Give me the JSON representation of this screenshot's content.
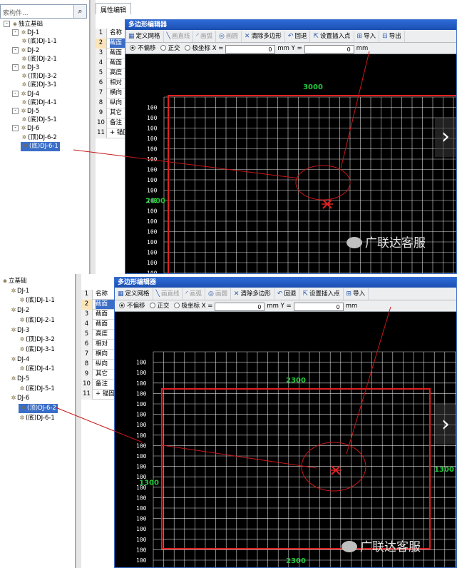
{
  "colors": {
    "accent": "#3a6ec8",
    "title_bar": "#1b4fb0",
    "polygon": "#e02020",
    "grid_line": "#ffffff",
    "dim_text": "#22c83c",
    "annotation": "#c81818"
  },
  "panel1": {
    "search_placeholder": "索构件...",
    "search_icon": "magnifier-icon",
    "tree": [
      {
        "label": "独立基础",
        "level": 0,
        "expander": "-"
      },
      {
        "label": "DJ-1",
        "level": 1,
        "expander": "-"
      },
      {
        "label": "(底)DJ-1-1",
        "level": 2
      },
      {
        "label": "DJ-2",
        "level": 1,
        "expander": "-"
      },
      {
        "label": "(底)DJ-2-1",
        "level": 2
      },
      {
        "label": "DJ-3",
        "level": 1,
        "expander": "-"
      },
      {
        "label": "(顶)DJ-3-2",
        "level": 2
      },
      {
        "label": "(底)DJ-3-1",
        "level": 2
      },
      {
        "label": "DJ-4",
        "level": 1,
        "expander": "-"
      },
      {
        "label": "(底)DJ-4-1",
        "level": 2
      },
      {
        "label": "DJ-5",
        "level": 1,
        "expander": "-"
      },
      {
        "label": "(底)DJ-5-1",
        "level": 2
      },
      {
        "label": "DJ-6",
        "level": 1,
        "expander": "-"
      },
      {
        "label": "(顶)DJ-6-2",
        "level": 2
      },
      {
        "label": "(底)DJ-6-1",
        "level": 2,
        "selected": true
      }
    ],
    "prop_tab": "属性编辑",
    "prop_rows": [
      {
        "num": "1",
        "name": "名称"
      },
      {
        "num": "2",
        "name": "截面",
        "selected": true
      },
      {
        "num": "3",
        "name": "截面"
      },
      {
        "num": "4",
        "name": "截面"
      },
      {
        "num": "5",
        "name": "高度"
      },
      {
        "num": "6",
        "name": "相对"
      },
      {
        "num": "7",
        "name": "横向"
      },
      {
        "num": "8",
        "name": "纵向"
      },
      {
        "num": "9",
        "name": "其它"
      },
      {
        "num": "10",
        "name": "备注"
      },
      {
        "num": "11",
        "name": "+ 锚固"
      }
    ],
    "dialog_title": "多边形编辑器",
    "toolbar": [
      {
        "label": "定义网格",
        "icon": "grid-icon",
        "enabled": true
      },
      {
        "label": "画直线",
        "icon": "line-icon",
        "enabled": false
      },
      {
        "label": "画弧",
        "icon": "arc-icon",
        "enabled": false
      },
      {
        "label": "画圆",
        "icon": "circle-icon",
        "enabled": false
      },
      {
        "label": "清除多边形",
        "icon": "clear-icon",
        "enabled": true
      },
      {
        "label": "回退",
        "icon": "undo-icon",
        "enabled": true
      },
      {
        "label": "设置插入点",
        "icon": "insert-point-icon",
        "enabled": true
      },
      {
        "label": "导入",
        "icon": "import-icon",
        "enabled": true
      },
      {
        "label": "导出",
        "icon": "export-icon",
        "enabled": true
      }
    ],
    "modes": [
      {
        "label": "不偏移",
        "checked": true
      },
      {
        "label": "正交",
        "checked": false
      },
      {
        "label": "极坐标",
        "checked": false
      }
    ],
    "x_label": "X =",
    "x_value": "0",
    "unit1": "mm",
    "y_label": "Y =",
    "y_value": "0",
    "unit2": "mm",
    "dim_top": "3000",
    "dim_left": "2000",
    "grid_label": "100",
    "watermark": "广联达客服"
  },
  "panel2": {
    "tree": [
      {
        "label": "立基础",
        "level": 0
      },
      {
        "label": "DJ-1",
        "level": 1
      },
      {
        "label": "(底)DJ-1-1",
        "level": 2
      },
      {
        "label": "DJ-2",
        "level": 1
      },
      {
        "label": "(底)DJ-2-1",
        "level": 2
      },
      {
        "label": "DJ-3",
        "level": 1
      },
      {
        "label": "(顶)DJ-3-2",
        "level": 2
      },
      {
        "label": "(底)DJ-3-1",
        "level": 2
      },
      {
        "label": "DJ-4",
        "level": 1
      },
      {
        "label": "(底)DJ-4-1",
        "level": 2
      },
      {
        "label": "DJ-5",
        "level": 1
      },
      {
        "label": "(底)DJ-5-1",
        "level": 2
      },
      {
        "label": "DJ-6",
        "level": 1
      },
      {
        "label": "(顶)DJ-6-2",
        "level": 2,
        "selected": true
      },
      {
        "label": "(底)DJ-6-1",
        "level": 2
      }
    ],
    "prop_rows": [
      {
        "num": "1",
        "name": "名称"
      },
      {
        "num": "2",
        "name": "截面",
        "selected": true
      },
      {
        "num": "3",
        "name": "截面"
      },
      {
        "num": "4",
        "name": "截面"
      },
      {
        "num": "5",
        "name": "高度"
      },
      {
        "num": "6",
        "name": "相对"
      },
      {
        "num": "7",
        "name": "横向"
      },
      {
        "num": "8",
        "name": "纵向"
      },
      {
        "num": "9",
        "name": "其它"
      },
      {
        "num": "10",
        "name": "备注"
      },
      {
        "num": "11",
        "name": "+ 锚固"
      }
    ],
    "dialog_title": "多边形编辑器",
    "toolbar": [
      {
        "label": "定义网格",
        "icon": "grid-icon",
        "enabled": true
      },
      {
        "label": "画直线",
        "icon": "line-icon",
        "enabled": false
      },
      {
        "label": "画弧",
        "icon": "arc-icon",
        "enabled": false
      },
      {
        "label": "画圆",
        "icon": "circle-icon",
        "enabled": false
      },
      {
        "label": "清除多边形",
        "icon": "clear-icon",
        "enabled": true
      },
      {
        "label": "回退",
        "icon": "undo-icon",
        "enabled": true
      },
      {
        "label": "设置插入点",
        "icon": "insert-point-icon",
        "enabled": true
      },
      {
        "label": "导入",
        "icon": "import-icon",
        "enabled": true
      }
    ],
    "modes": [
      {
        "label": "不偏移",
        "checked": true
      },
      {
        "label": "正交",
        "checked": false
      },
      {
        "label": "极坐标",
        "checked": false
      }
    ],
    "x_label": "X =",
    "x_value": "0",
    "unit1": "mm",
    "y_label": "Y =",
    "y_value": "0",
    "unit2": "mm",
    "dim_top": "2300",
    "dim_bottom": "2300",
    "dim_left": "1300",
    "dim_right": "1300",
    "grid_label": "100",
    "watermark": "广联达客服"
  }
}
